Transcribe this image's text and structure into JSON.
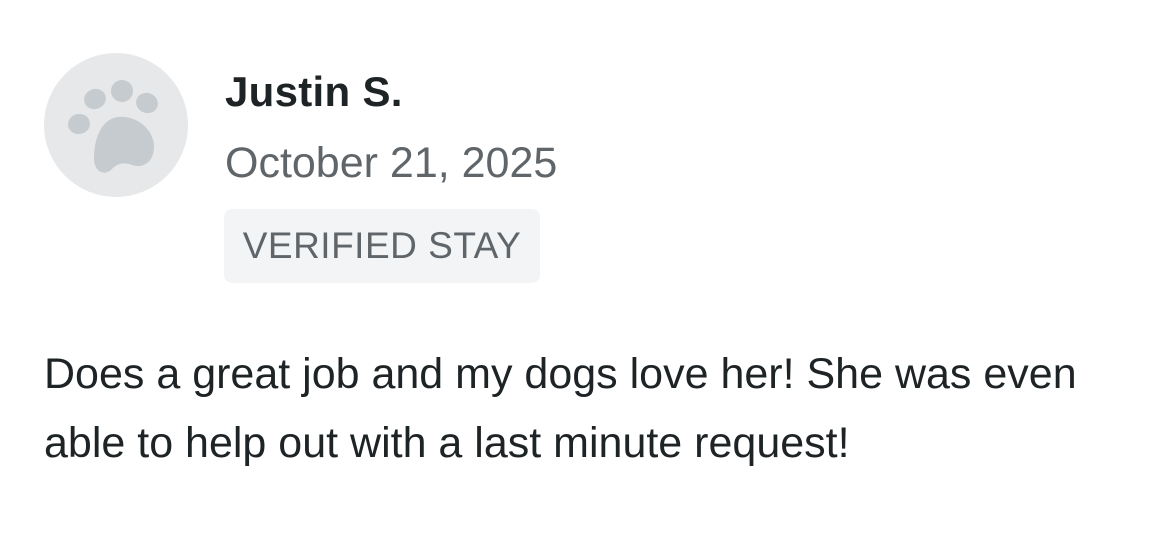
{
  "review": {
    "avatar_icon": "paw-icon",
    "reviewer_name": "Justin S.",
    "date": "October 21, 2025",
    "badge": "VERIFIED STAY",
    "text": "Does a great job and my dogs love her! She was even able to help out with a last minute request!"
  },
  "colors": {
    "avatar_bg": "#e6e8ea",
    "paw": "#c5cbcf",
    "name": "#1e2326",
    "muted": "#5f6569",
    "badge_bg": "#f2f4f6"
  }
}
